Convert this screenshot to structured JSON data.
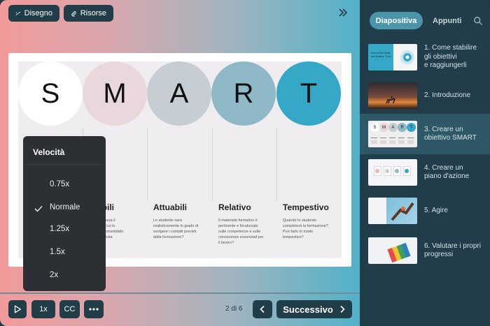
{
  "toolbar": {
    "draw_label": "Disegno",
    "resources_label": "Risorse"
  },
  "slide": {
    "letters": [
      "S",
      "M",
      "A",
      "R",
      "T"
    ],
    "circle_colors": [
      "#ffffff",
      "#e8d8dc",
      "#c6cdd3",
      "#8fb9c6",
      "#35a8c7"
    ],
    "columns": [
      {
        "title": "urabili",
        "lines": [
          "misura il",
          "on cui lo",
          "e consolidato",
          "questa",
          "e?"
        ]
      },
      {
        "title": "Attuabili",
        "lines": [
          "Lo studente sarà",
          "realisticamente in grado di",
          "svolgere i compiti previsti",
          "dalla formazione?"
        ]
      },
      {
        "title": "Relativo",
        "lines": [
          "Il materiale formativo è",
          "pertinente e focalizzato",
          "sulle competenze e sulle",
          "conoscenze essenziali per",
          "il lavoro?"
        ]
      },
      {
        "title": "Tempestivo",
        "lines": [
          "Quando lo studente",
          "completerà la formazione?",
          "Può farlo in modo",
          "tempestivo?"
        ]
      }
    ]
  },
  "speed_menu": {
    "title": "Velocità",
    "options": [
      "0.75x",
      "Normale",
      "1.25x",
      "1.5x",
      "2x"
    ],
    "selected": "Normale"
  },
  "controls": {
    "speed_label": "1x",
    "cc_label": "CC",
    "page_indicator": "2 di 6",
    "next_label": "Successivo"
  },
  "sidebar": {
    "tab_slides": "Diapositiva",
    "tab_notes": "Appunti",
    "active_index": 2,
    "items": [
      {
        "label": "1. Come stabilire gli obiettivi e raggiungerli",
        "lines": [
          "1. Come stabilire",
          "gli obiettivi",
          "e raggiungerli"
        ],
        "thumb_text": [
          "How to Set Goals",
          "and Achieve Them"
        ]
      },
      {
        "label": "2. Introduzione",
        "lines": [
          "2. Introduzione"
        ]
      },
      {
        "label": "3. Creare un obiettivo SMART",
        "lines": [
          "3. Creare un",
          "obiettivo SMART"
        ],
        "thumb_text": [
          "S",
          "M",
          "A",
          "R",
          "T"
        ]
      },
      {
        "label": "4. Creare un piano d'azione",
        "lines": [
          "4. Creare un",
          "piano d'azione"
        ]
      },
      {
        "label": "5. Agire",
        "lines": [
          "5. Agire"
        ]
      },
      {
        "label": "6. Valutare i propri progressi",
        "lines": [
          "6. Valutare i propri",
          "progressi"
        ]
      }
    ]
  }
}
